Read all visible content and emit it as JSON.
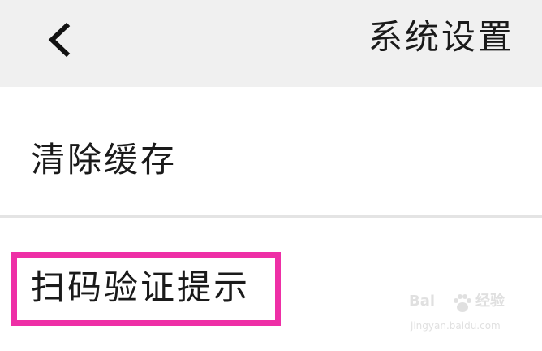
{
  "header": {
    "title": "系统设置",
    "back_icon": "chevron-left-icon"
  },
  "settings": {
    "items": [
      {
        "label": "清除缓存"
      },
      {
        "label": "扫码验证提示"
      }
    ]
  },
  "highlight": {
    "color": "#ee2fa6"
  },
  "watermark": {
    "brand": "Bai",
    "brand_suffix": "经验",
    "url": "jingyan.baidu.com",
    "icon": "paw-icon"
  }
}
